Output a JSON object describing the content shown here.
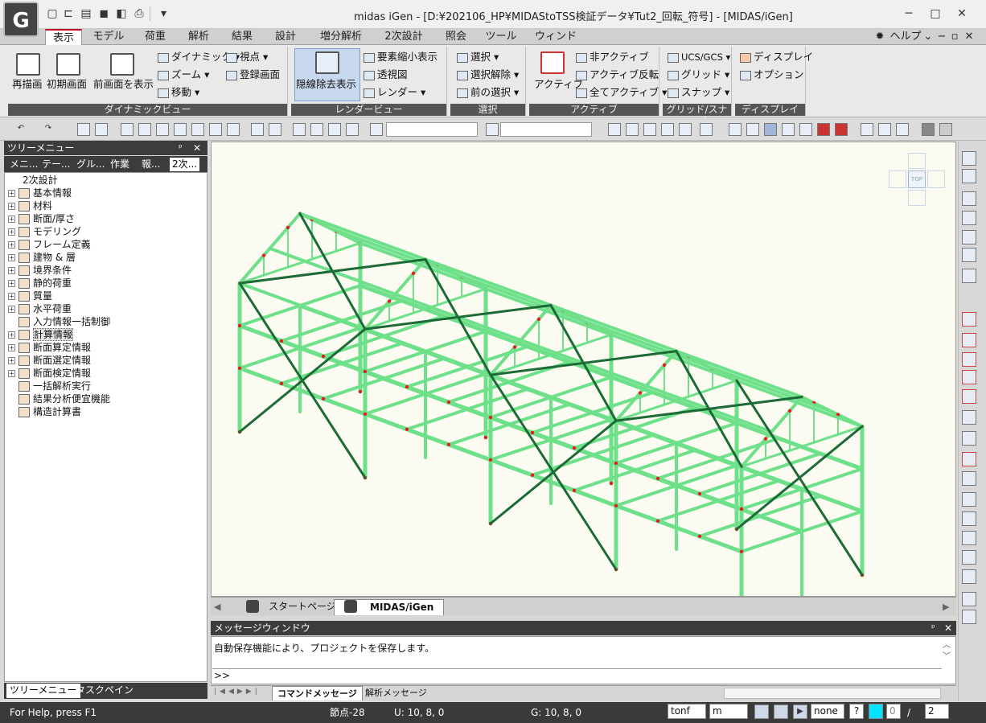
{
  "window": {
    "title": "midas iGen - [D:¥202106_HP¥MIDAStoTSS検証データ¥Tut2_回転_符号] - [MIDAS/iGen]",
    "logo_text": "G",
    "quick_access_icons": [
      "new-file-icon",
      "open-folder-icon",
      "open-recent-icon",
      "save-icon",
      "save-as-icon",
      "print-icon",
      "print-preview-icon",
      "customize-qa-icon"
    ],
    "controls": {
      "minimize": "─",
      "maximize": "□",
      "close": "✕"
    }
  },
  "menu": {
    "tabs": [
      "表示",
      "モデル",
      "荷重",
      "解析",
      "結果",
      "設計",
      "増分解析",
      "2次設計",
      "照会",
      "ツール",
      "ウィンドウ"
    ],
    "active_tab": "表示",
    "help_label": "ヘルプ",
    "help_arrow": "⌄",
    "mdi_controls": [
      "−",
      "▫",
      "✕"
    ]
  },
  "ribbon": {
    "groups": [
      {
        "name": "ダイナミックビュー"
      },
      {
        "name": "レンダービュー"
      },
      {
        "name": "選択"
      },
      {
        "name": "アクティブ"
      },
      {
        "name": "グリッド/スナップ"
      },
      {
        "name": "ディスプレイ"
      }
    ],
    "dynamic_view": {
      "redraw": "再描画",
      "initial_view": "初期画面",
      "previous_view": "前画面を表示",
      "dynamic": "ダイナミック",
      "zoom": "ズーム",
      "pan": "移動",
      "viewpoint": "視点",
      "named_view": "登録画面"
    },
    "render_view": {
      "hidden_line": "隠線除去表示",
      "shrink": "要素縮小表示",
      "perspective": "透視図",
      "render": "レンダー"
    },
    "select": {
      "select": "選択",
      "unselect": "選択解除",
      "previous": "前の選択"
    },
    "active": {
      "active": "アクティブ",
      "inactive": "非アクティブ",
      "invert": "アクティブ反転",
      "all_active": "全てアクティブ"
    },
    "grid_snap": {
      "ucs": "UCS/GCS",
      "grid": "グリッド",
      "snap": "スナップ"
    },
    "display": {
      "display": "ディスプレイ",
      "option": "オプション"
    }
  },
  "tree_panel": {
    "title": "ツリーメニュー",
    "pin_glyph": "ᵖ",
    "close_glyph": "✕",
    "tabs": [
      "メニ...",
      "テー...",
      "グル...",
      "作業",
      "報...",
      "2次..."
    ],
    "active_tab": "2次...",
    "root": "2次設計",
    "items": [
      {
        "label": "基本情報",
        "expandable": true
      },
      {
        "label": "材料",
        "expandable": true
      },
      {
        "label": "断面/厚さ",
        "expandable": true
      },
      {
        "label": "モデリング",
        "expandable": true
      },
      {
        "label": "フレーム定義",
        "expandable": true
      },
      {
        "label": "建物 & 層",
        "expandable": true
      },
      {
        "label": "境界条件",
        "expandable": true
      },
      {
        "label": "静的荷重",
        "expandable": true
      },
      {
        "label": "質量",
        "expandable": true
      },
      {
        "label": "水平荷重",
        "expandable": true
      },
      {
        "label": "入力情報一括制御",
        "expandable": false
      },
      {
        "label": "計算情報",
        "expandable": true,
        "selected": true
      },
      {
        "label": "断面算定情報",
        "expandable": true
      },
      {
        "label": "断面選定情報",
        "expandable": true
      },
      {
        "label": "断面検定情報",
        "expandable": true
      },
      {
        "label": "一括解析実行",
        "expandable": false
      },
      {
        "label": "結果分析便宜機能",
        "expandable": false
      },
      {
        "label": "構造計算書",
        "expandable": false
      }
    ],
    "bottom_tabs": [
      "ツリーメニュー",
      "タスクペイン"
    ],
    "active_bottom_tab": "ツリーメニュー"
  },
  "viewport": {
    "view_cube_label": "TOP",
    "doc_tabs": [
      "スタートページ",
      "MIDAS/iGen"
    ],
    "active_doc_tab": "MIDAS/iGen",
    "model_color": "#6ee08a",
    "brace_color": "#1c6b36",
    "node_color": "#e02020"
  },
  "message_window": {
    "title": "メッセージウィンドウ",
    "pin_glyph": "ᵖ",
    "close_glyph": "✕",
    "message": "自動保存機能により、プロジェクトを保存します。",
    "prompt": ">>",
    "tabs": [
      "コマンドメッセージ",
      "解析メッセージ"
    ],
    "active_tab": "コマンドメッセージ"
  },
  "status_bar": {
    "help": "For Help, press F1",
    "node": "節点-28",
    "ucs": "U: 10, 8, 0",
    "gcs": "G: 10, 8, 0",
    "force_unit": "tonf",
    "length_unit": "m",
    "filter": "none",
    "help_btn": "?",
    "page_current": "0",
    "page_sep": "/",
    "page_total": "2"
  }
}
